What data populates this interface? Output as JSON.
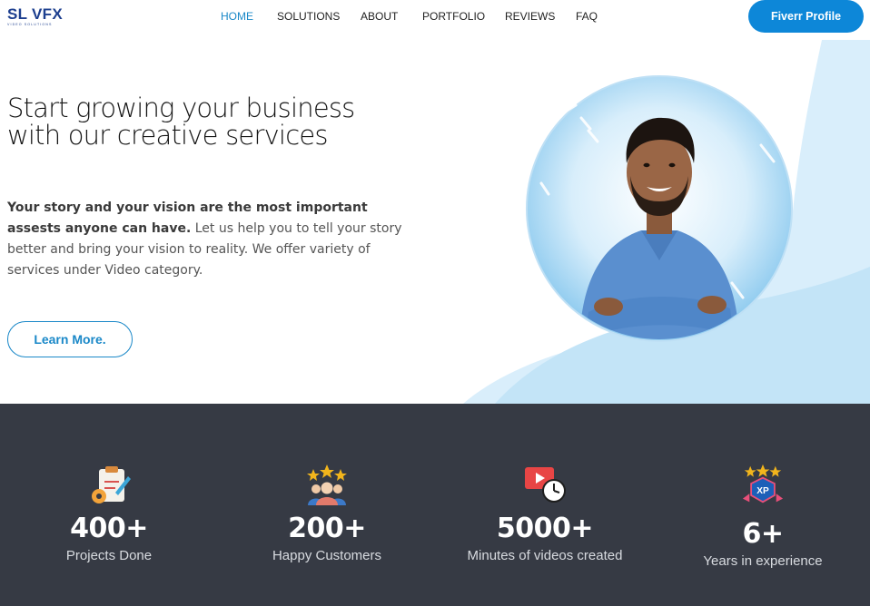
{
  "brand": {
    "name": "SL VFX",
    "tagline": "VIDEO SOLUTIONS",
    "color": "#1d3f8f"
  },
  "nav": {
    "items": [
      {
        "label": "HOME",
        "active": true
      },
      {
        "label": "SOLUTIONS",
        "active": false
      },
      {
        "label": "ABOUT",
        "active": false
      },
      {
        "label": "PORTFOLIO",
        "active": false
      },
      {
        "label": "REVIEWS",
        "active": false
      },
      {
        "label": "FAQ",
        "active": false
      }
    ],
    "cta_label": "Fiverr Profile"
  },
  "hero": {
    "title_line1": "Start growing your business",
    "title_line2": "with our creative services",
    "text_bold": "Your story and your vision are the most important assests anyone can have.",
    "text_regular": " Let us help you to tell your story better and bring your vision to reality. We offer variety of services under Video category.",
    "button_label": "Learn More.",
    "portrait_icon": "person-portrait-icon"
  },
  "stats": [
    {
      "value": "400+",
      "label": "Projects Done",
      "icon": "clipboard-gear-icon"
    },
    {
      "value": "200+",
      "label": "Happy Customers",
      "icon": "customers-stars-icon"
    },
    {
      "value": "5000+",
      "label": "Minutes of videos created",
      "icon": "video-clock-icon"
    },
    {
      "value": "6+",
      "label": "Years in experience",
      "icon": "xp-badge-icon"
    }
  ],
  "colors": {
    "accent": "#1a88c8",
    "cta_bg": "#0d87d8",
    "stats_bg": "#363a44",
    "hero_wave": "#cfe9f8"
  }
}
